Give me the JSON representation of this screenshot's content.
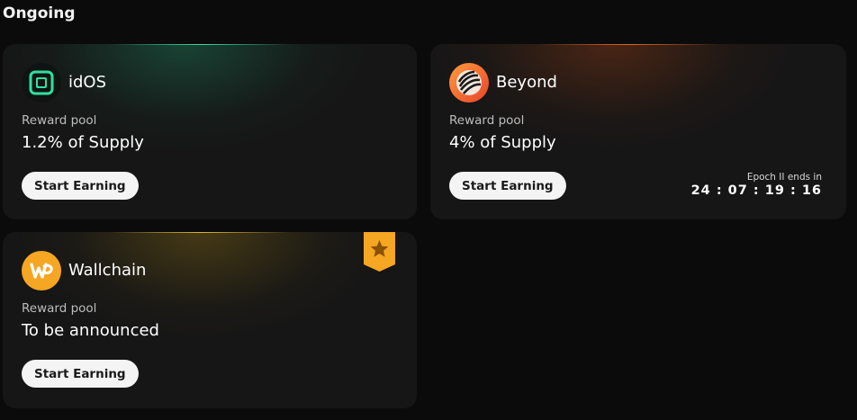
{
  "section": {
    "title": "Ongoing"
  },
  "cards": [
    {
      "name": "idOS",
      "reward_label": "Reward pool",
      "reward_value": "1.2% of Supply",
      "button_label": "Start Earning",
      "logo_icon": "idos-logo-icon",
      "accent": "#3fd9a0"
    },
    {
      "name": "Beyond",
      "reward_label": "Reward pool",
      "reward_value": "4% of Supply",
      "button_label": "Start Earning",
      "logo_icon": "beyond-logo-icon",
      "accent": "#e0672a",
      "epoch_label": "Epoch II ends in",
      "epoch_time": "24 : 07 : 19 : 16"
    },
    {
      "name": "Wallchain",
      "reward_label": "Reward pool",
      "reward_value": "To be announced",
      "button_label": "Start Earning",
      "logo_icon": "wallchain-logo-icon",
      "accent": "#f5a623",
      "badge_icon": "star-bookmark-icon"
    }
  ]
}
